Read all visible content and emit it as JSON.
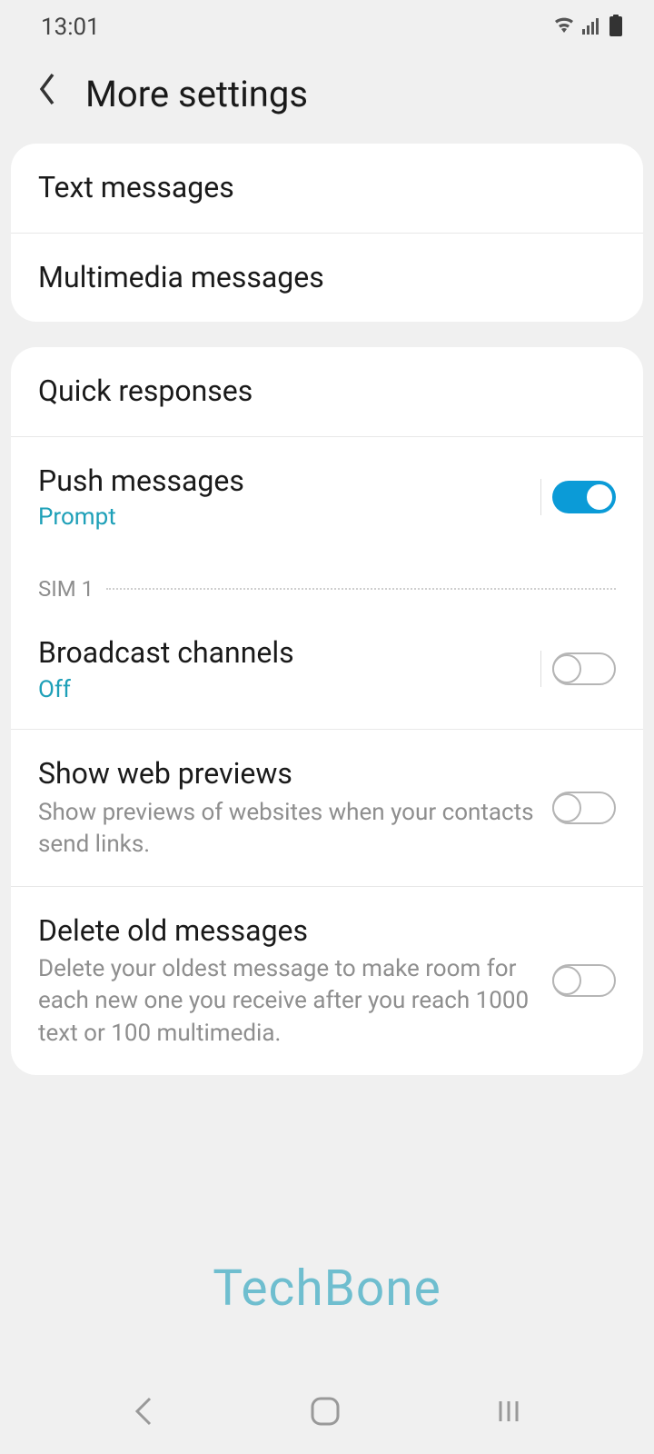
{
  "status": {
    "time": "13:01"
  },
  "header": {
    "title": "More settings"
  },
  "group1": {
    "text_messages": "Text messages",
    "multimedia_messages": "Multimedia messages"
  },
  "group2": {
    "quick_responses": "Quick responses",
    "push_messages": {
      "title": "Push messages",
      "subtitle": "Prompt",
      "enabled": true
    },
    "section_label": "SIM 1",
    "broadcast_channels": {
      "title": "Broadcast channels",
      "subtitle": "Off",
      "enabled": false
    },
    "show_web_previews": {
      "title": "Show web previews",
      "description": "Show previews of websites when your contacts send links.",
      "enabled": false
    },
    "delete_old_messages": {
      "title": "Delete old messages",
      "description": "Delete your oldest message to make room for each new one you receive after you reach 1000 text or 100 multimedia.",
      "enabled": false
    }
  },
  "watermark": "TechBone"
}
